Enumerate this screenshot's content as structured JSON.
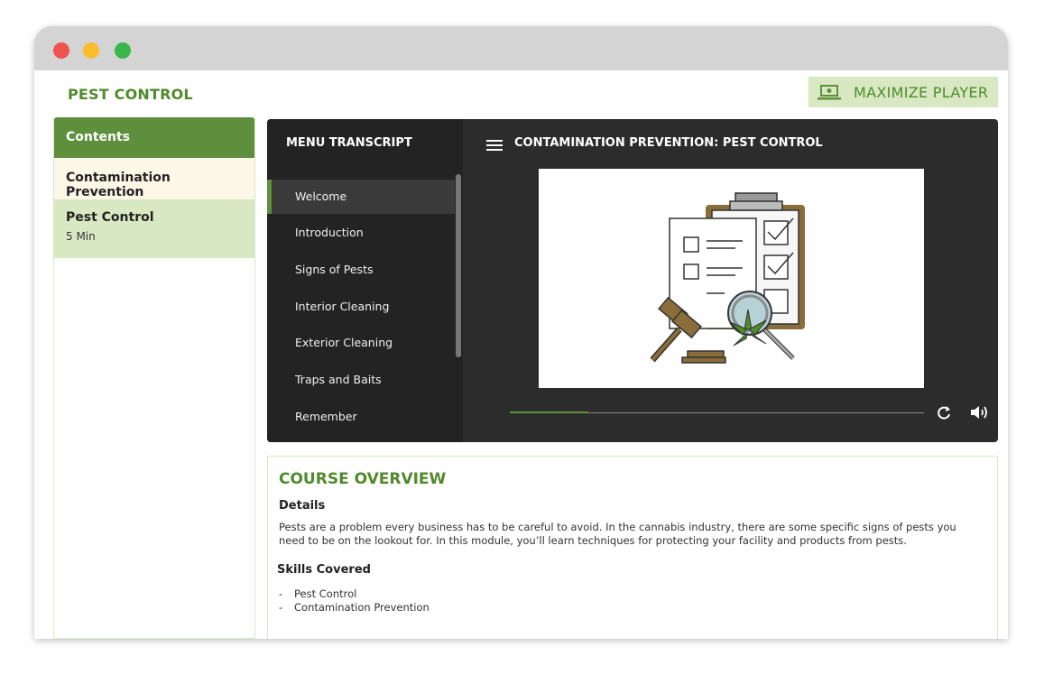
{
  "app": {
    "title": "PEST CONTROL"
  },
  "maximize": {
    "label": "MAXIMIZE PLAYER",
    "icon": "laptop-icon"
  },
  "sidebar": {
    "heading": "Contents",
    "section": "Contamination Prevention",
    "items": [
      {
        "title": "Pest Control",
        "duration": "5 Min"
      }
    ]
  },
  "player": {
    "menu_title": "MENU TRANSCRIPT",
    "lesson_title": "CONTAMINATION PREVENTION: PEST CONTROL",
    "menu_items": [
      {
        "label": "Welcome",
        "active": true
      },
      {
        "label": "Introduction"
      },
      {
        "label": "Signs of Pests"
      },
      {
        "label": "Interior Cleaning"
      },
      {
        "label": "Exterior Cleaning"
      },
      {
        "label": "Traps and Baits"
      },
      {
        "label": "Remember"
      }
    ],
    "progress_fraction": 0.19,
    "icons": [
      "hamburger-menu-icon",
      "replay-icon",
      "volume-icon"
    ]
  },
  "overview": {
    "title": "COURSE OVERVIEW",
    "details_heading": "Details",
    "description": "Pests are a problem every business has to be careful to avoid. In the cannabis industry, there are some specific signs of pests you need to be on the lookout for. In this module, you’ll learn techniques for protecting your facility and products from pests.",
    "skills_heading": "Skills Covered",
    "skills": [
      "Pest Control",
      "Contamination Prevention"
    ]
  },
  "colors": {
    "accent": "#5e8f3c",
    "accent_light": "#d8e8c3",
    "player_bg": "#2c2c2c"
  }
}
